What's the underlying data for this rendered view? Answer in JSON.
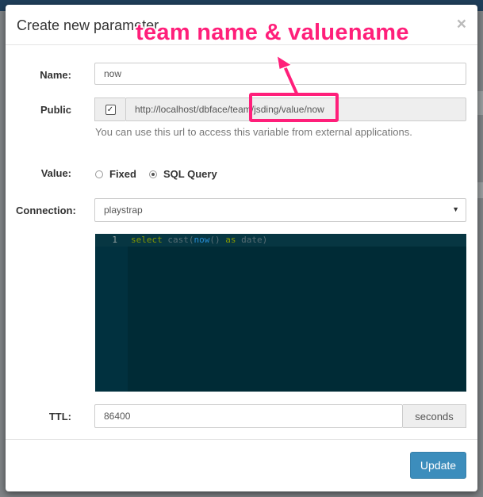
{
  "dialog": {
    "title": "Create new parameter",
    "close_symbol": "×"
  },
  "form": {
    "name_label": "Name:",
    "name_value": "now",
    "public_label": "Public",
    "public_checked": true,
    "url_value": "http://localhost/dbface/team/jsding/value/now",
    "help_text": "You can use this url to access this variable from external applications.",
    "value_label": "Value:",
    "value_options": [
      {
        "label": "Fixed",
        "checked": false
      },
      {
        "label": "SQL Query",
        "checked": true
      }
    ],
    "connection_label": "Connection:",
    "connection_value": "playstrap",
    "editor": {
      "line_number": "1",
      "code": "select cast(now() as date)"
    },
    "ttl_label": "TTL:",
    "ttl_value": "86400",
    "ttl_unit": "seconds"
  },
  "footer": {
    "update_label": "Update"
  },
  "annotation": {
    "text": "team name & valuename",
    "color": "#ff1f7a"
  }
}
